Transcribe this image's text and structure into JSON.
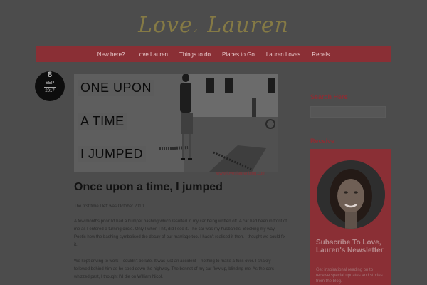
{
  "site": {
    "logo_left": "Love",
    "logo_sep": ",",
    "logo_right": "Lauren"
  },
  "nav": {
    "items": [
      "New here?",
      "Love Lauren",
      "Things to do",
      "Places to Go",
      "Lauren Loves",
      "Rebels"
    ]
  },
  "post": {
    "date": {
      "day": "8",
      "month": "SEP",
      "year": "2017"
    },
    "hero": {
      "line1": "ONE UPON",
      "line2": "A TIME",
      "line3": "I JUMPED",
      "caption": "www.loveslaurenblog.com"
    },
    "title": "Once upon a time, I jumped",
    "paragraphs": [
      "The first time I left was October 2010…",
      "A few months prior I'd had a bumper bashing which resulted in my car being written off. A car had been in front of me as I entered a turning circle. Only I when I hit, did I see it. The car was my husband's. Blocking my way. Poetic how the bashing symbolised the decay of our marriage too. I hadn't realised it then. I thought we could fix it.",
      "We kept driving to work – couldn't be late. It was just an accident – nothing to make a fuss over. I shakily followed behind him as he sped down the highway. The bonnet of my car flew up, blinding me. As the cars whizzed past, I thought I'd die on William Nicol."
    ]
  },
  "sidebar": {
    "search_heading": "Search Here",
    "receive_heading": "Receive",
    "newsletter_title": "Subscribe To Love, Lauren's Newsletter",
    "newsletter_desc": "Get inspirational reading on to receive special updates and stories from the blog."
  },
  "colors": {
    "accent": "#8a2f35",
    "overlay_bg": "#4c4c4c",
    "logo_gold": "#857a45"
  }
}
